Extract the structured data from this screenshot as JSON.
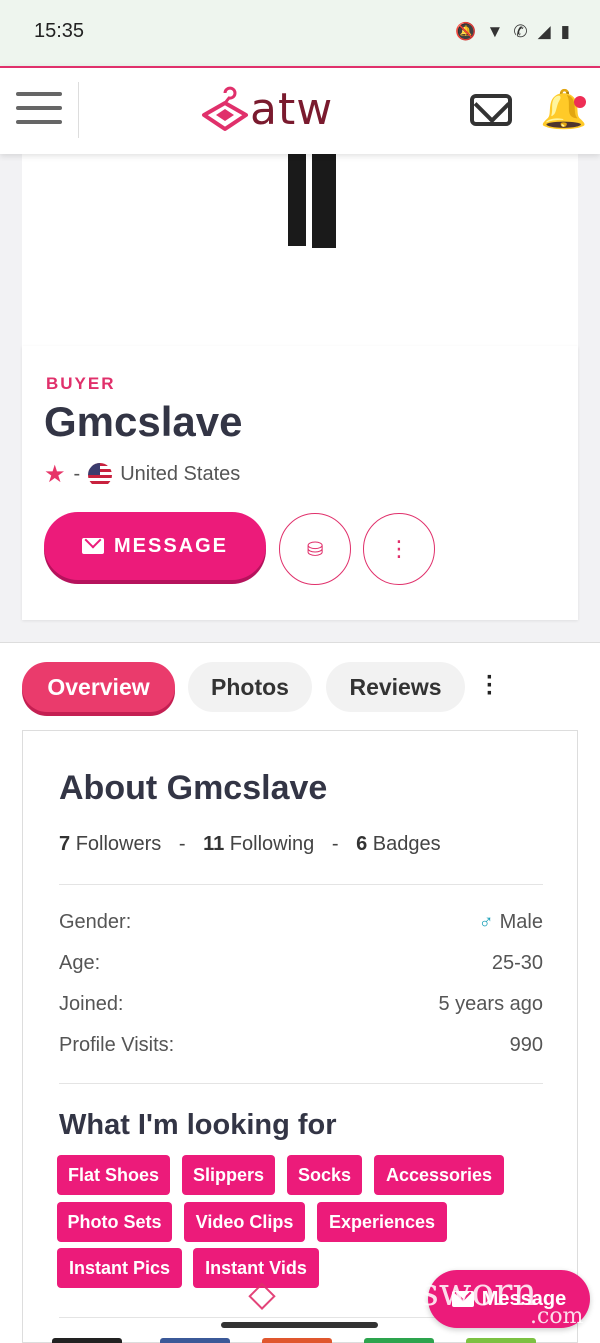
{
  "status_bar": {
    "time": "15:35"
  },
  "header": {
    "logo_text": "atw"
  },
  "profile": {
    "role": "BUYER",
    "username": "Gmcslave",
    "rating": "-",
    "country": "United States",
    "message_button": "MESSAGE"
  },
  "tabs": [
    {
      "label": "Overview",
      "active": true
    },
    {
      "label": "Photos",
      "active": false
    },
    {
      "label": "Reviews",
      "active": false
    }
  ],
  "about": {
    "title": "About Gmcslave",
    "followers_count": "7",
    "followers_label": "Followers",
    "following_count": "11",
    "following_label": "Following",
    "badges_count": "6",
    "badges_label": "Badges",
    "details": [
      {
        "label": "Gender:",
        "value": "Male"
      },
      {
        "label": "Age:",
        "value": "25-30"
      },
      {
        "label": "Joined:",
        "value": "5 years ago"
      },
      {
        "label": "Profile Visits:",
        "value": "990"
      }
    ],
    "looking_for_title": "What I'm looking for",
    "looking_for": [
      "Flat Shoes",
      "Slippers",
      "Socks",
      "Accessories",
      "Photo Sets",
      "Video Clips",
      "Experiences",
      "Instant Pics",
      "Instant Vids"
    ]
  },
  "watermark": {
    "text": "gsworn",
    "suffix": ".com"
  },
  "fab": {
    "label": "Message"
  },
  "colors": {
    "accent": "#ec1b7a",
    "brand_dark": "#7a1a2e",
    "tab_active": "#ea3b6c"
  }
}
